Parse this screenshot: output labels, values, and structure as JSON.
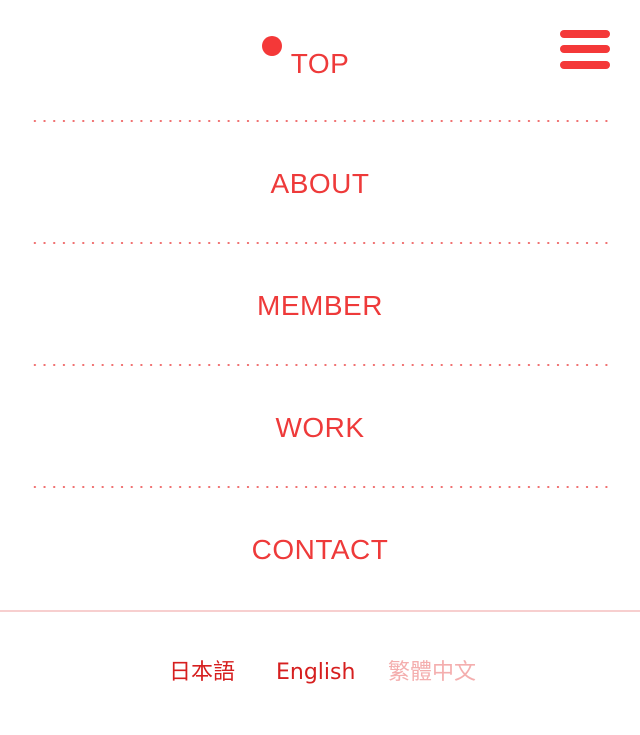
{
  "nav": {
    "items": [
      {
        "label": "TOP",
        "current": true
      },
      {
        "label": "ABOUT",
        "current": false
      },
      {
        "label": "MEMBER",
        "current": false
      },
      {
        "label": "WORK",
        "current": false
      },
      {
        "label": "CONTACT",
        "current": false
      }
    ]
  },
  "languages": {
    "items": [
      {
        "label": "日本語",
        "state": "available"
      },
      {
        "label": "English",
        "state": "available"
      },
      {
        "label": "繁體中文",
        "state": "disabled"
      }
    ]
  },
  "colors": {
    "accent": "#ee3a3a",
    "separator": "#f07070",
    "footer_line": "#f7cfcf",
    "lang_active": "#d61f1f",
    "lang_inactive": "#f4aeae",
    "background": "#ffffff"
  },
  "icons": {
    "menu": "hamburger-icon",
    "current_marker": "current-page-dot-icon"
  }
}
